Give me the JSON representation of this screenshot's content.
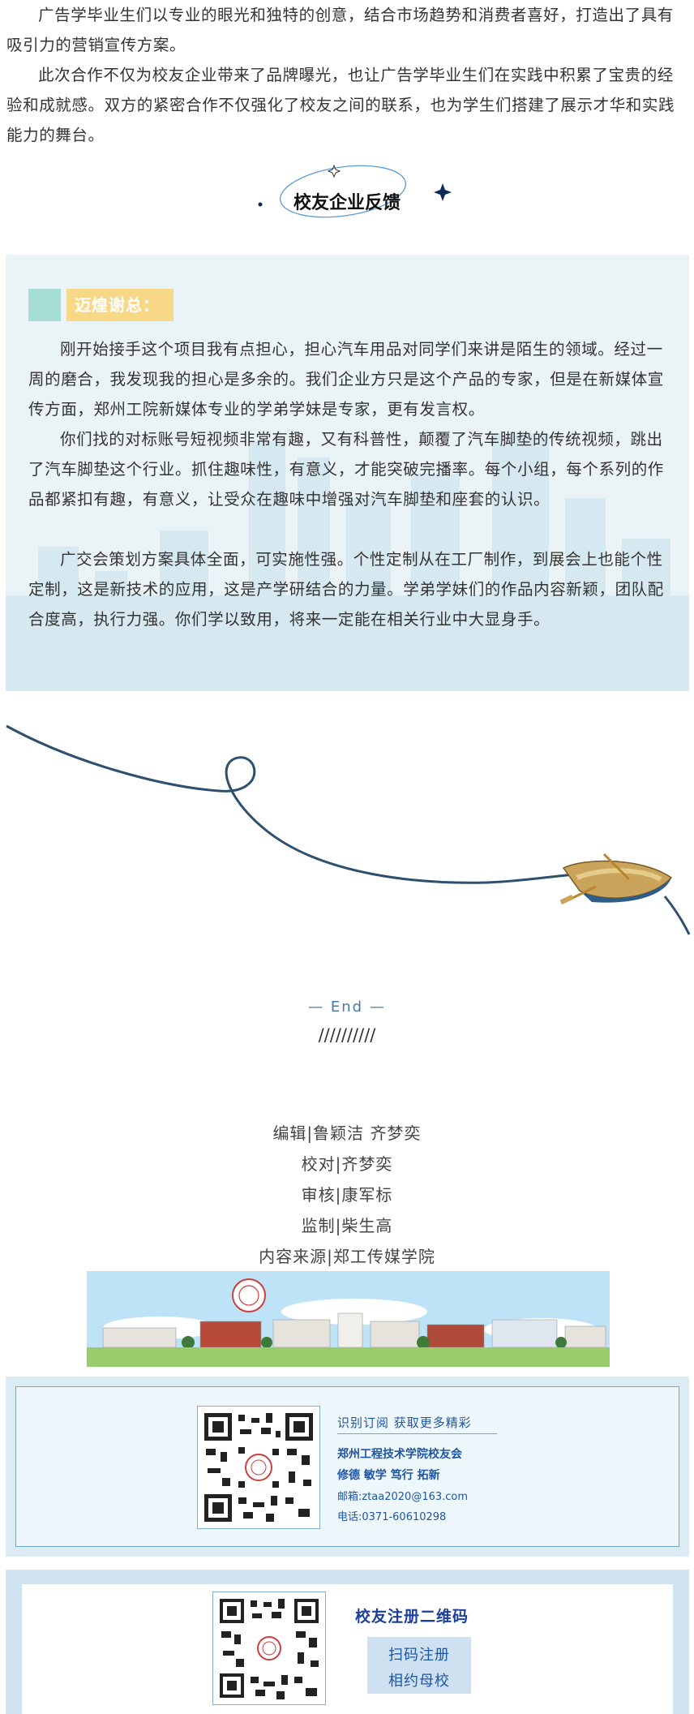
{
  "intro_paragraphs": [
    "广告学毕业生们以专业的眼光和独特的创意，结合市场趋势和消费者喜好，打造出了具有吸引力的营销宣传方案。",
    "此次合作不仅为校友企业带来了品牌曝光，也让广告学毕业生们在实践中积累了宝贵的经验和成就感。双方的紧密合作不仅强化了校友之间的联系，也为学生们搭建了展示才华和实践能力的舞台。"
  ],
  "section_heading": "校友企业反馈",
  "feedback": {
    "speaker": "迈煌谢总：",
    "paragraphs": [
      "刚开始接手这个项目我有点担心，担心汽车用品对同学们来讲是陌生的领域。经过一周的磨合，我发现我的担心是多余的。我们企业方只是这个产品的专家，但是在新媒体宣传方面，郑州工院新媒体专业的学弟学妹是专家，更有发言权。",
      "你们找的对标账号短视频非常有趣，又有科普性，颠覆了汽车脚垫的传统视频，跳出了汽车脚垫这个行业。抓住趣味性，有意义，才能突破完播率。每个小组，每个系列的作品都紧扣有趣，有意义，让受众在趣味中增强对汽车脚垫和座套的认识。",
      "广交会策划方案具体全面，可实施性强。个性定制从在工厂制作，到展会上也能个性定制，这是新技术的应用，这是产学研结合的力量。学弟学妹们的作品内容新颖，团队配合度高，执行力强。你们学以致用，将来一定能在相关行业中大显身手。"
    ]
  },
  "end_label": "— End —",
  "end_slashes": "//////////",
  "credits": [
    "编辑|鲁颖洁 齐梦奕",
    "校对|齐梦奕",
    "审核|康军标",
    "监制|柴生高",
    "内容来源|郑工传媒学院"
  ],
  "subscribe": {
    "headline": "识别订阅  获取更多精彩",
    "org": "郑州工程技术学院校友会",
    "motto": "修德  敏学  笃行  拓新",
    "email": "邮箱:ztaa2020@163.com",
    "phone": "电话:0371-60610298"
  },
  "registration": {
    "title": "校友注册二维码",
    "line1": "扫码注册",
    "line2": "相约母校"
  },
  "colors": {
    "accent_blue": "#1c3f9e",
    "teal_square": "#a6dcd6",
    "name_tag": "#f7d887",
    "rope": "#2f4f6f"
  },
  "icons": [
    "sparkle-icon",
    "star-icon",
    "school-seal-icon",
    "boat-icon",
    "qr-code-icon"
  ]
}
